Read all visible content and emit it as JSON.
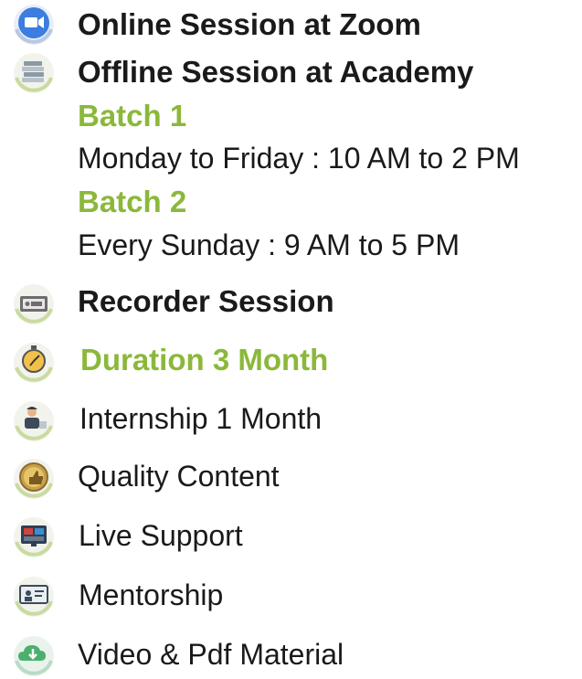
{
  "accent_green": "#8bb83a",
  "items": {
    "online": {
      "label": "Online Session at Zoom",
      "icon": "zoom-camera-icon"
    },
    "offline": {
      "label": "Offline Session at Academy",
      "icon": "books-stack-icon",
      "batches": [
        {
          "title": "Batch 1",
          "schedule": "Monday to Friday : 10 AM to 2 PM"
        },
        {
          "title": "Batch 2",
          "schedule": "Every Sunday : 9 AM to 5 PM"
        }
      ]
    },
    "recorded": {
      "label": "Recorder Session",
      "icon": "rec-screen-icon"
    },
    "duration": {
      "label": "Duration 3 Month",
      "icon": "stopwatch-icon"
    },
    "internship": {
      "label": "Internship 1 Month",
      "icon": "intern-person-icon"
    },
    "quality": {
      "label": "Quality Content",
      "icon": "thumbs-up-icon"
    },
    "support": {
      "label": "Live Support",
      "icon": "live-support-icon"
    },
    "mentorship": {
      "label": "Mentorship",
      "icon": "mentor-board-icon"
    },
    "material": {
      "label": "Video & Pdf Material",
      "icon": "cloud-download-icon"
    }
  }
}
